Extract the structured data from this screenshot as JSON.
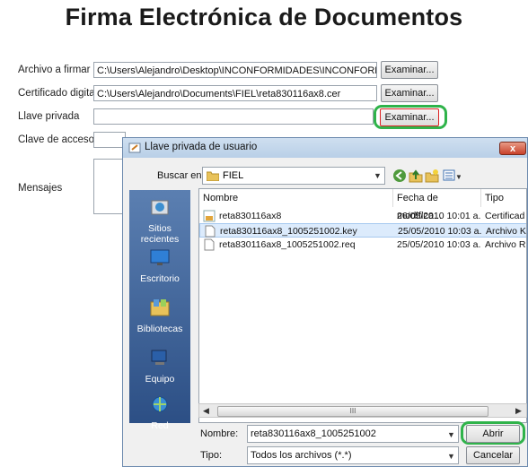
{
  "page": {
    "title": "Firma Electrónica de Documentos"
  },
  "form": {
    "archivo": {
      "label": "Archivo a firmar",
      "value": "C:\\Users\\Alejandro\\Desktop\\INCONFORMIDADES\\INCONFORMIDA",
      "button": "Examinar..."
    },
    "certificado": {
      "label": "Certificado digital",
      "value": "C:\\Users\\Alejandro\\Documents\\FIEL\\reta830116ax8.cer",
      "button": "Examinar..."
    },
    "llave": {
      "label": "Llave privada",
      "value": "",
      "button": "Examinar..."
    },
    "clave": {
      "label": "Clave de acceso",
      "value": ""
    },
    "mensajes": {
      "label": "Mensajes",
      "value": ""
    }
  },
  "dialog": {
    "title": "Llave privada de usuario",
    "close_label": "x",
    "lookin_label": "Buscar en:",
    "lookin_value": "FIEL",
    "places": [
      {
        "label": "Sitios recientes",
        "icon": "recent-places-icon"
      },
      {
        "label": "Escritorio",
        "icon": "desktop-icon"
      },
      {
        "label": "Bibliotecas",
        "icon": "libraries-icon"
      },
      {
        "label": "Equipo",
        "icon": "computer-icon"
      },
      {
        "label": "Red",
        "icon": "network-icon"
      }
    ],
    "columns": [
      "Nombre",
      "Fecha de modifica...",
      "Tipo"
    ],
    "files": [
      {
        "name": "reta830116ax8",
        "date": "26/05/2010 10:01 a...",
        "type": "Certificad",
        "icon": "certificate-file-icon",
        "selected": false
      },
      {
        "name": "reta830116ax8_1005251002.key",
        "date": "25/05/2010 10:03 a...",
        "type": "Archivo K",
        "icon": "file-icon",
        "selected": true
      },
      {
        "name": "reta830116ax8_1005251002.req",
        "date": "25/05/2010 10:03 a...",
        "type": "Archivo R",
        "icon": "file-icon",
        "selected": false
      }
    ],
    "scroll_grip": "III",
    "filename_label": "Nombre:",
    "filename_value": "reta830116ax8_1005251002",
    "filetype_label": "Tipo:",
    "filetype_value": "Todos los archivos (*.*)",
    "open_button": "Abrir",
    "cancel_button": "Cancelar"
  },
  "colors": {
    "highlight_green": "#2fb34a",
    "highlight_red": "#dd2222",
    "places_bar": "#3a5f95",
    "selection": "#dcebfc"
  }
}
